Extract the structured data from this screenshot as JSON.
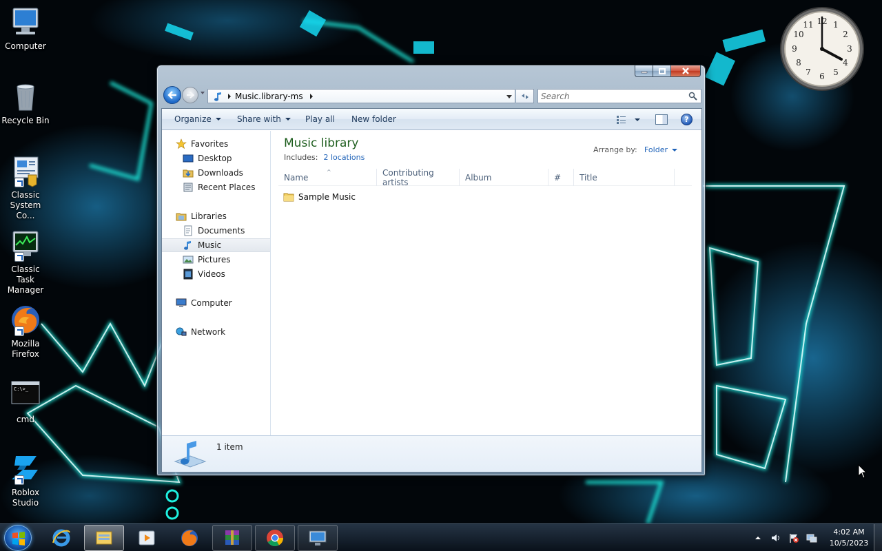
{
  "desktop": {
    "icons": [
      {
        "label": "Computer",
        "icon": "computer-icon"
      },
      {
        "label": "Recycle Bin",
        "icon": "recycle-bin-icon"
      },
      {
        "label": "Classic System Co...",
        "icon": "control-panel-icon"
      },
      {
        "label": "Classic Task Manager",
        "icon": "task-manager-icon"
      },
      {
        "label": "Mozilla Firefox",
        "icon": "firefox-icon"
      },
      {
        "label": "cmd",
        "icon": "cmd-icon"
      },
      {
        "label": "Roblox Studio",
        "icon": "roblox-studio-icon"
      }
    ],
    "cmd_icon_text": "C:\\>_"
  },
  "clock_gadget": {
    "numbers": [
      "12",
      "1",
      "2",
      "3",
      "4",
      "5",
      "6",
      "7",
      "8",
      "9",
      "10",
      "11"
    ]
  },
  "explorer": {
    "address": {
      "path": "Music.library-ms"
    },
    "search": {
      "placeholder": "Search"
    },
    "toolbar": {
      "organize": "Organize",
      "share_with": "Share with",
      "play_all": "Play all",
      "new_folder": "New folder",
      "help": "?"
    },
    "nav": {
      "favorites": "Favorites",
      "desktop": "Desktop",
      "downloads": "Downloads",
      "recent_places": "Recent Places",
      "libraries": "Libraries",
      "documents": "Documents",
      "music": "Music",
      "pictures": "Pictures",
      "videos": "Videos",
      "computer": "Computer",
      "network": "Network"
    },
    "library": {
      "title": "Music library",
      "includes_label": "Includes:",
      "includes_link": "2 locations",
      "arrange_by_label": "Arrange by:",
      "arrange_by_value": "Folder"
    },
    "columns": [
      "Name",
      "Contributing artists",
      "Album",
      "#",
      "Title"
    ],
    "files": [
      {
        "name": "Sample Music",
        "type": "folder"
      }
    ],
    "details": {
      "count": "1 item"
    }
  },
  "taskbar": {
    "pinned": [
      "internet-explorer-icon",
      "windows-explorer-icon",
      "media-player-icon",
      "firefox-icon",
      "winrar-icon",
      "chrome-icon",
      "remote-desktop-icon"
    ],
    "time": "4:02 AM",
    "date": "10/5/2023"
  },
  "colors": {
    "accent_glow": "#19e6e6",
    "wallpaper_bg": "#02060a",
    "library_title": "#1e5e1e",
    "link": "#1e62b8"
  }
}
